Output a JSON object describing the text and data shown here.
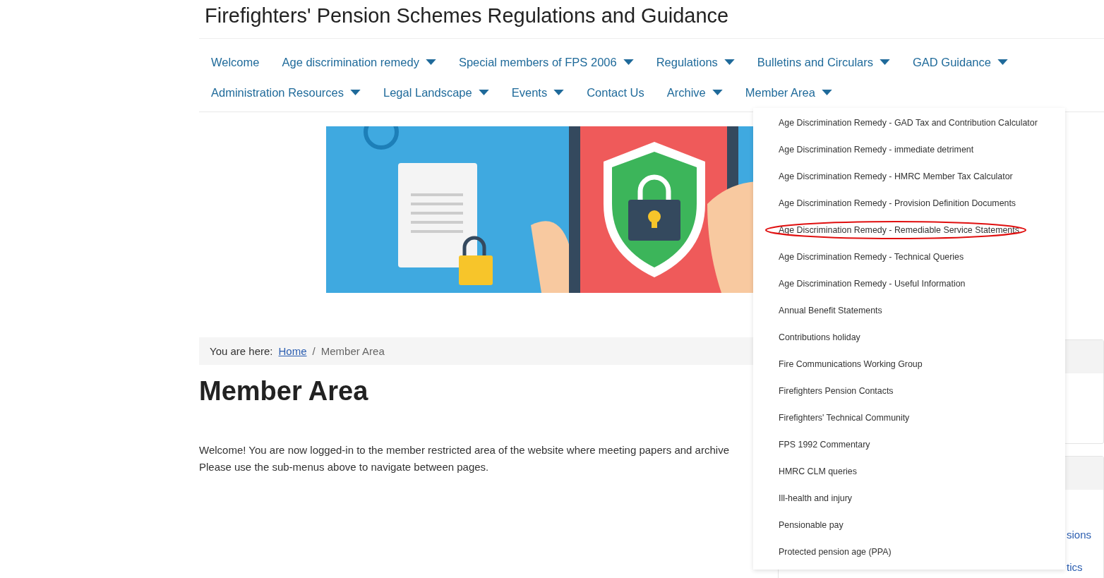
{
  "site_title": "Firefighters' Pension Schemes Regulations and Guidance",
  "nav": {
    "items": [
      {
        "label": "Welcome",
        "has_submenu": false
      },
      {
        "label": "Age discrimination remedy",
        "has_submenu": true
      },
      {
        "label": "Special members of FPS 2006",
        "has_submenu": true
      },
      {
        "label": "Regulations",
        "has_submenu": true
      },
      {
        "label": "Bulletins and Circulars",
        "has_submenu": true
      },
      {
        "label": "GAD Guidance",
        "has_submenu": true
      },
      {
        "label": "Administration Resources",
        "has_submenu": true
      },
      {
        "label": "Legal Landscape",
        "has_submenu": true
      },
      {
        "label": "Events",
        "has_submenu": true
      },
      {
        "label": "Contact Us",
        "has_submenu": false
      },
      {
        "label": "Archive",
        "has_submenu": true
      },
      {
        "label": "Member Area",
        "has_submenu": true
      }
    ]
  },
  "dropdown": {
    "items": [
      {
        "label": "Age Discrimination Remedy - GAD Tax and Contribution Calculator",
        "circled": false
      },
      {
        "label": "Age Discrimination Remedy - immediate detriment",
        "circled": false
      },
      {
        "label": "Age Discrimination Remedy - HMRC Member Tax Calculator",
        "circled": false
      },
      {
        "label": "Age Discrimination Remedy - Provision Definition Documents",
        "circled": false
      },
      {
        "label": "Age Discrimination Remedy - Remediable Service Statements",
        "circled": true
      },
      {
        "label": "Age Discrimination Remedy - Technical Queries",
        "circled": false
      },
      {
        "label": "Age Discrimination Remedy - Useful Information",
        "circled": false
      },
      {
        "label": "Annual Benefit Statements",
        "circled": false
      },
      {
        "label": "Contributions holiday",
        "circled": false
      },
      {
        "label": "Fire Communications Working Group",
        "circled": false
      },
      {
        "label": "Firefighters Pension Contacts",
        "circled": false
      },
      {
        "label": "Firefighters' Technical Community",
        "circled": false
      },
      {
        "label": "FPS 1992 Commentary",
        "circled": false
      },
      {
        "label": "HMRC CLM queries",
        "circled": false
      },
      {
        "label": "Ill-health and injury",
        "circled": false
      },
      {
        "label": "Pensionable pay",
        "circled": false
      },
      {
        "label": "Protected pension age (PPA)",
        "circled": false
      }
    ]
  },
  "breadcrumb": {
    "prefix": "You are here:",
    "links": [
      "Home"
    ],
    "separator": "/",
    "current": "Member Area"
  },
  "heading": "Member Area",
  "paragraphs": [
    "Welcome! You are now logged-in to the member restricted area of the website where meeting papers and archive",
    "Please use the sub-menus above to navigate between pages."
  ],
  "sidebar": {
    "links": [
      "sions",
      "tics"
    ]
  }
}
